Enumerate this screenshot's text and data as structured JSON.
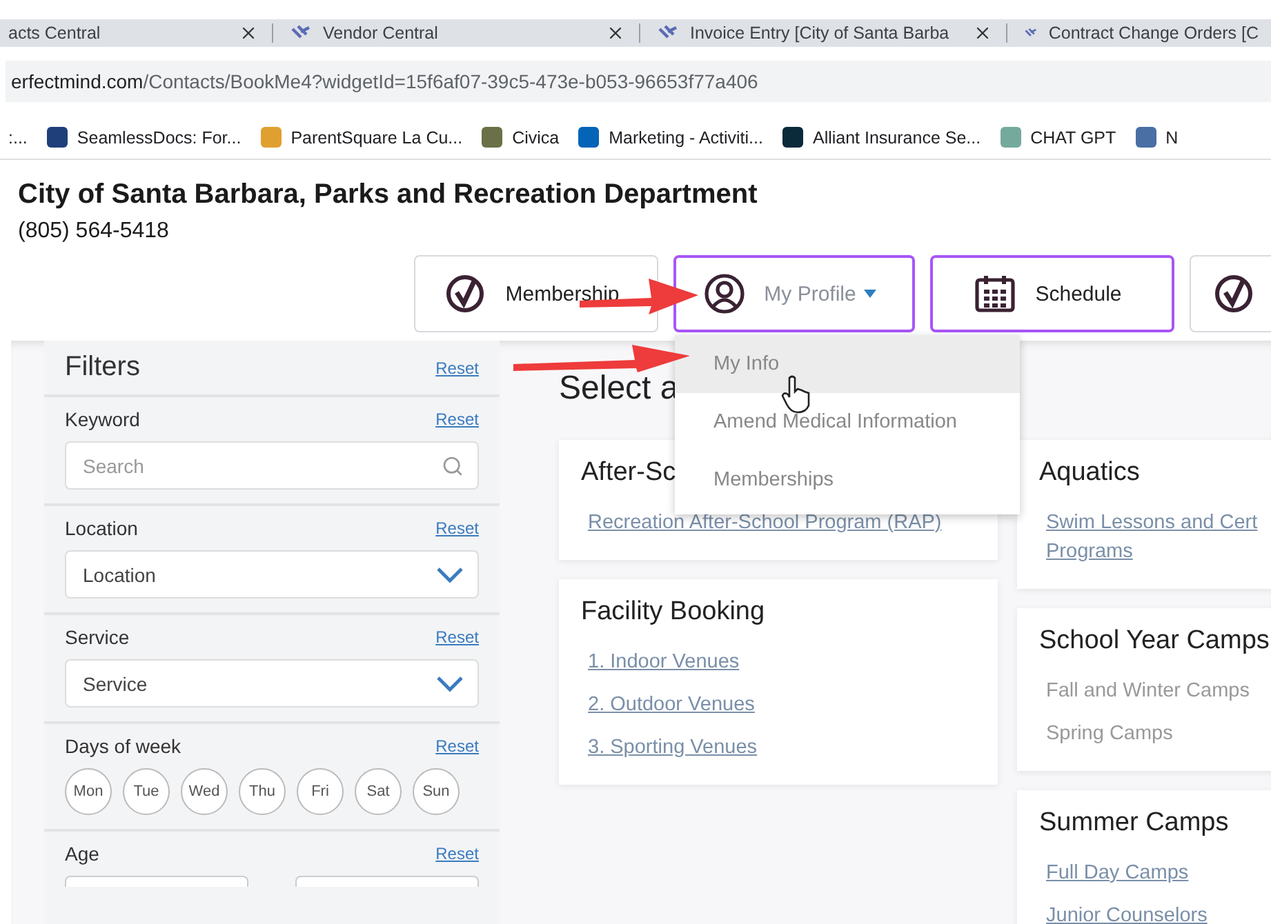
{
  "browser_tabs": [
    {
      "title": "acts Central",
      "has_icon": false
    },
    {
      "title": "Vendor Central",
      "has_icon": true
    },
    {
      "title": "Invoice Entry [City of Santa Barba",
      "has_icon": true
    },
    {
      "title": "Contract Change Orders [C",
      "has_icon": true
    }
  ],
  "address_bar": {
    "domain": "erfectmind.com",
    "path": "/Contacts/BookMe4?widgetId=15f6af07-39c5-473e-b053-96653f77a406"
  },
  "bookmarks": [
    {
      "label": ":..."
    },
    {
      "label": "SeamlessDocs: For...",
      "color": "#1f3f7a"
    },
    {
      "label": "ParentSquare La Cu...",
      "color": "#e0a030"
    },
    {
      "label": "Civica",
      "color": "#6b7048"
    },
    {
      "label": "Marketing - Activiti...",
      "color": "#0364b8"
    },
    {
      "label": "Alliant Insurance Se...",
      "color": "#0b2a3a"
    },
    {
      "label": "CHAT GPT",
      "color": "#74aa9c"
    },
    {
      "label": "N",
      "color": "#4a6fa5"
    }
  ],
  "header": {
    "title": "City of Santa Barbara, Parks and Recreation Department",
    "phone": "(805) 564-5418"
  },
  "nav_buttons": [
    {
      "kind": "logo",
      "label": "Membership",
      "highlighted": false,
      "has_caret": false
    },
    {
      "kind": "person",
      "label": "My Profile",
      "highlighted": true,
      "has_caret": true
    },
    {
      "kind": "calendar",
      "label": "Schedule",
      "highlighted": true,
      "has_caret": false
    },
    {
      "kind": "logo",
      "highlighted": false,
      "has_caret": false
    }
  ],
  "profile_menu": [
    {
      "label": "My Info",
      "highlighted": true
    },
    {
      "label": "Amend Medical Information",
      "highlighted": false
    },
    {
      "label": "Memberships",
      "highlighted": false
    }
  ],
  "filters": {
    "title": "Filters",
    "reset": "Reset",
    "sections": [
      {
        "kind": "search",
        "label": "Keyword",
        "reset": "Reset",
        "placeholder": "Search"
      },
      {
        "kind": "select",
        "label": "Location",
        "reset": "Reset",
        "value": "Location"
      },
      {
        "kind": "select",
        "label": "Service",
        "reset": "Reset",
        "value": "Service"
      },
      {
        "kind": "days",
        "label": "Days of week",
        "reset": "Reset",
        "days": [
          "Mon",
          "Tue",
          "Wed",
          "Thu",
          "Fri",
          "Sat",
          "Sun"
        ]
      },
      {
        "kind": "age",
        "label": "Age",
        "reset": "Reset"
      }
    ]
  },
  "main": {
    "heading": "Select a",
    "columns": [
      [
        {
          "title": "After-Sc",
          "items": [
            {
              "kind": "link",
              "lines": [
                "Recreation After-School Program (RAP)"
              ]
            }
          ]
        },
        {
          "title": "Facility Booking",
          "items": [
            {
              "kind": "link",
              "lines": [
                "1. Indoor Venues"
              ]
            },
            {
              "kind": "link",
              "lines": [
                "2. Outdoor Venues"
              ]
            },
            {
              "kind": "link",
              "lines": [
                "3. Sporting Venues"
              ]
            }
          ]
        }
      ],
      [
        {
          "title": "Aquatics",
          "items": [
            {
              "kind": "link",
              "lines": [
                "Swim Lessons and Cert",
                "Programs"
              ]
            }
          ]
        },
        {
          "title": "School Year Camps",
          "items": [
            {
              "kind": "text",
              "lines": [
                "Fall and Winter Camps"
              ]
            },
            {
              "kind": "text",
              "lines": [
                "Spring Camps"
              ]
            }
          ]
        },
        {
          "title": "Summer Camps",
          "items": [
            {
              "kind": "link",
              "lines": [
                "Full Day Camps"
              ]
            },
            {
              "kind": "link",
              "lines": [
                "Junior Counselors"
              ]
            }
          ]
        }
      ]
    ]
  }
}
